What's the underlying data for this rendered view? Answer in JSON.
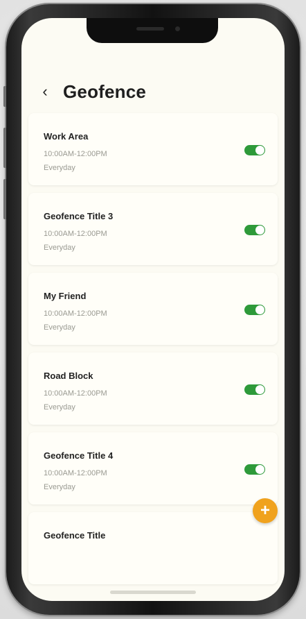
{
  "header": {
    "back_icon": "‹",
    "title": "Geofence"
  },
  "geofences": [
    {
      "title": "Work Area",
      "time": "10:00AM-12:00PM",
      "days": "Everyday",
      "enabled": true
    },
    {
      "title": "Geofence Title 3",
      "time": "10:00AM-12:00PM",
      "days": "Everyday",
      "enabled": true
    },
    {
      "title": "My Friend",
      "time": "10:00AM-12:00PM",
      "days": "Everyday",
      "enabled": true
    },
    {
      "title": "Road Block",
      "time": "10:00AM-12:00PM",
      "days": "Everyday",
      "enabled": true
    },
    {
      "title": "Geofence Title 4",
      "time": "10:00AM-12:00PM",
      "days": "Everyday",
      "enabled": true
    },
    {
      "title": "Geofence Title"
    }
  ],
  "fab": {
    "icon": "+",
    "color": "#f0a21d"
  },
  "colors": {
    "toggle_on": "#2e9a3a",
    "screen_bg": "#fcfbf3"
  }
}
